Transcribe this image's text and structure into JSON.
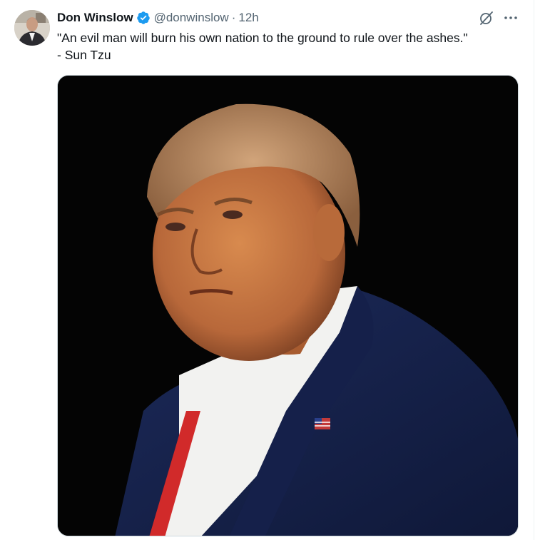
{
  "tweet": {
    "author_name": "Don Winslow",
    "handle": "@donwinslow",
    "separator": "·",
    "time": "12h",
    "text_line1": "\"An evil man will burn his own nation to the ground to rule over the ashes.\"",
    "text_line2": "- Sun Tzu",
    "verified_icon": "verified-badge-icon",
    "grok_icon": "grok-icon",
    "more_icon": "more-options-icon"
  },
  "colors": {
    "accent": "#1d9bf0",
    "secondary_text": "#536471",
    "primary_text": "#0f1419",
    "media_background": "#040404"
  }
}
